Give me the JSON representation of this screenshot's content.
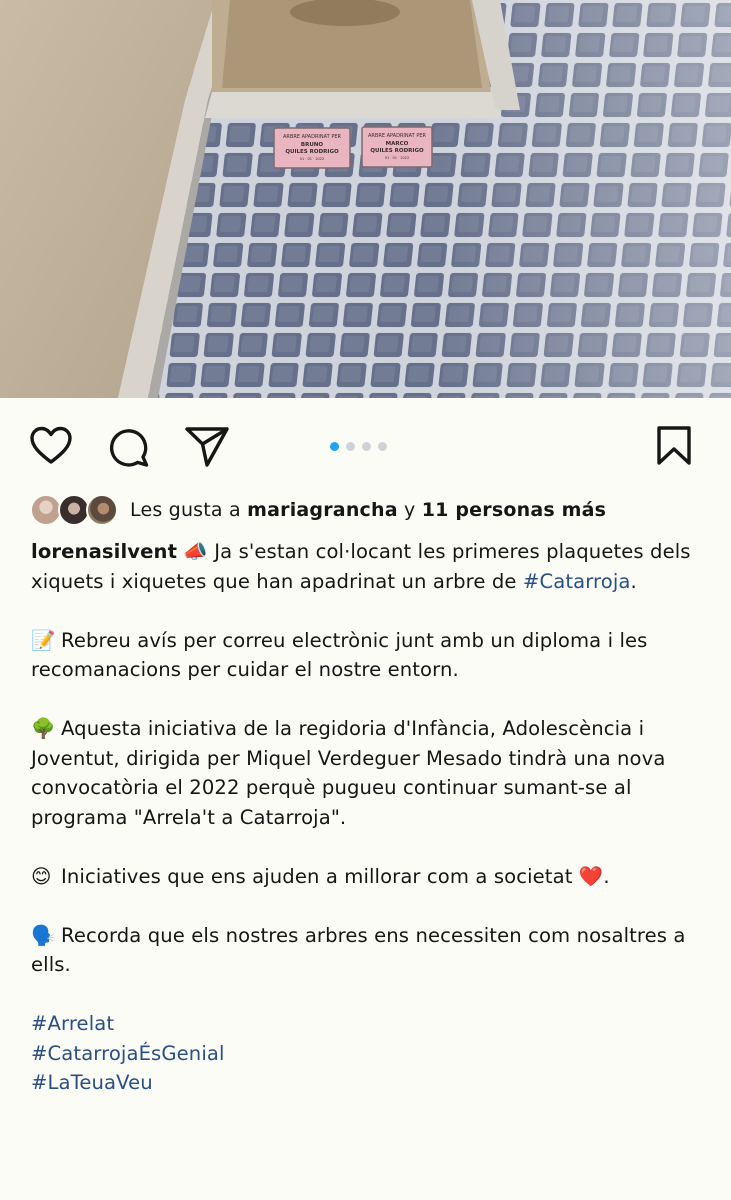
{
  "post": {
    "photo": {
      "plaque_left": [
        "ARBRE APADRINAT PER",
        "BRUNO",
        "QUILES RODRIGO",
        "01 · 01 · 2022"
      ],
      "plaque_right": [
        "ARBRE APADRINAT PER",
        "MARCO",
        "QUILES RODRIGO",
        "01 · 01 · 2022"
      ]
    },
    "actions": {
      "like_icon": "heart-icon",
      "comment_icon": "comment-icon",
      "share_icon": "paper-plane-icon",
      "save_icon": "bookmark-icon",
      "carousel_dots": 4,
      "carousel_active": 1,
      "accent_color": "#1fa3f0"
    },
    "likes": {
      "prefix": "Les gusta a",
      "user": "mariagrancha",
      "joiner": "y",
      "others": "11 personas más"
    },
    "caption": {
      "username": "lorenasilvent",
      "p1_emoji": "📣",
      "p1_text": "Ja s'estan col·locant les primeres plaquetes dels xiquets i xiquetes que han apadrinat un arbre de",
      "p1_tag": "#Catarroja",
      "p1_end": ".",
      "p2_emoji": "📝",
      "p2_text": "Rebreu avís per correu electrònic junt amb un diploma i les recomanacions per cuidar el nostre entorn.",
      "p3_emoji": "🌳",
      "p3_text": "Aquesta iniciativa de la regidoria d'Infància, Adolescència i Joventut, dirigida per Miquel Verdeguer Mesado tindrà una nova convocatòria el 2022 perquè pugueu continuar sumant-se al programa \"Arrela't a Catarroja\".",
      "p4_emoji": "😊",
      "p4_text": "Iniciatives que ens ajuden a millorar com a societat",
      "p4_heart": "❤️",
      "p4_end": ".",
      "p5_emoji": "🗣️",
      "p5_text": "Recorda que els nostres arbres ens necessiten com nosaltres a ells.",
      "hashtags": [
        "#Arrelat",
        "#CatarrojaÉsGenial",
        "#LaTeuaVeu"
      ]
    }
  }
}
